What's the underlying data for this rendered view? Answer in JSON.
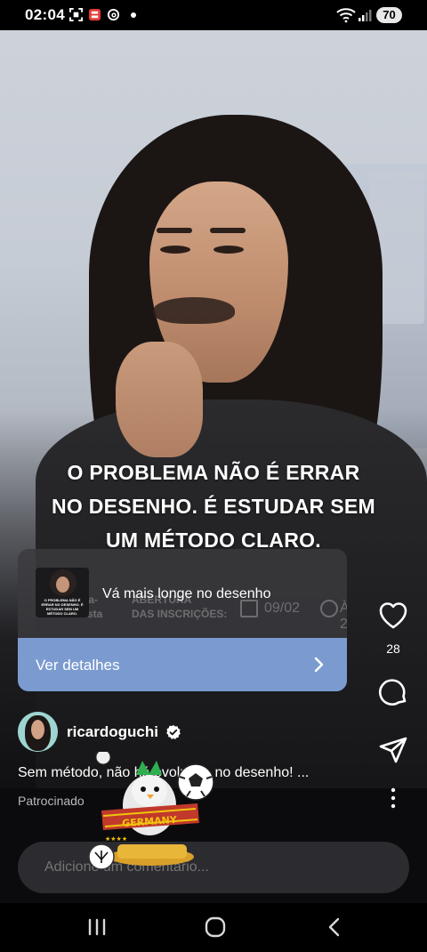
{
  "status_bar": {
    "time": "02:04",
    "battery": "70",
    "icons": [
      "screenshot-icon",
      "app-icon",
      "threads-icon",
      "notification-dot",
      "wifi-icon",
      "signal-icon"
    ]
  },
  "post": {
    "overlay_text": [
      "O PROBLEMA NÃO É ERRAR",
      "NO DESENHO. É ESTUDAR SEM",
      "UM MÉTODO CLARO."
    ],
    "ad": {
      "title": "Vá mais longe no desenho",
      "cta_label": "Ver detalhes",
      "thumbnail_text": "O PROBLEMA NÃO É ERRAR NO DESENHO. É ESTUDAR SEM UM MÉTODO CLARO.",
      "background_text": {
        "word1": "da-",
        "word2": "sta",
        "line1": "ABERTURA",
        "line2": "DAS INSCRIÇÕES:",
        "date": "09/02",
        "time": "ÀS 20H"
      }
    },
    "likes": "28",
    "username": "ricardoguchi",
    "caption": "Sem método, não há evolução no desenho! ...",
    "sponsored_label": "Patrocinado"
  },
  "sticker": {
    "banner_text": "GERMANY"
  },
  "comment": {
    "placeholder": "Adicione um comentário..."
  },
  "colors": {
    "cta": "#7b9bd0",
    "comment_bar": "#2b2b30",
    "background": "#0b0b0d"
  }
}
